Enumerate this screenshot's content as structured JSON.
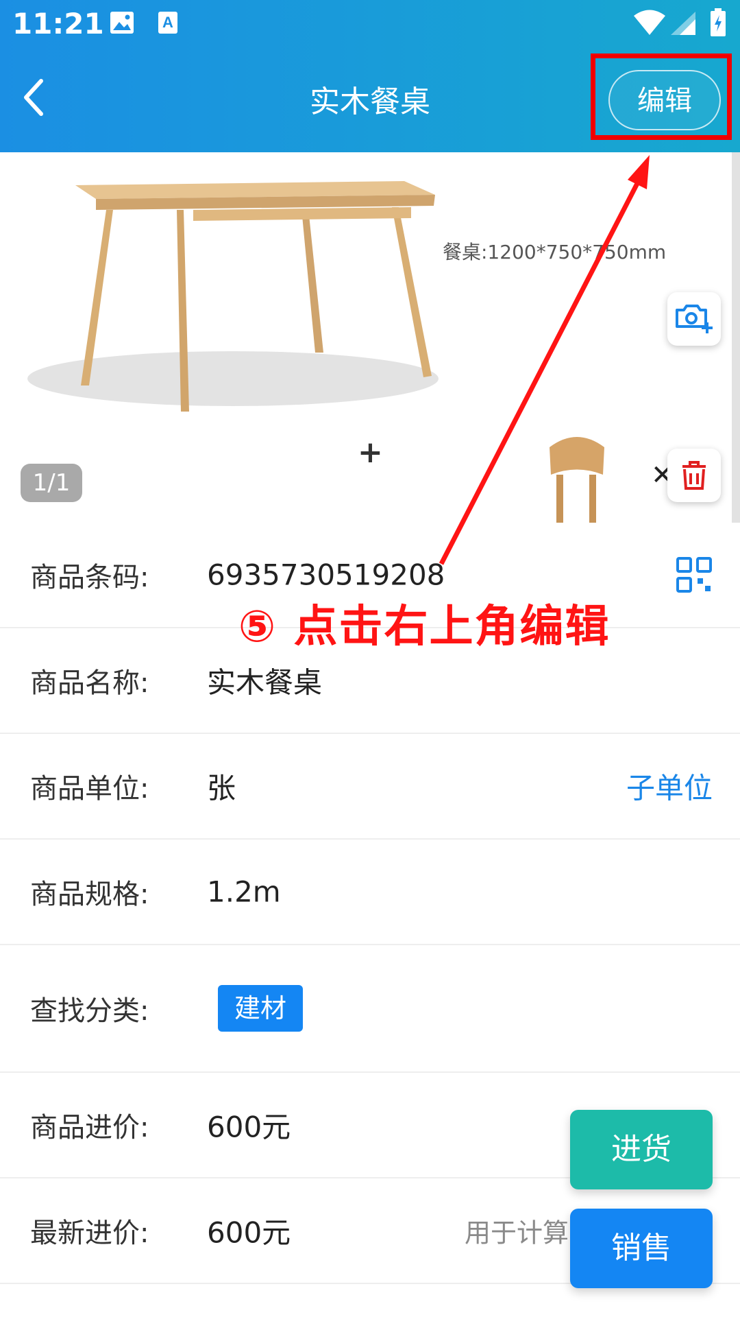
{
  "status_bar": {
    "time": "11:21"
  },
  "header": {
    "title": "实木餐桌",
    "edit_label": "编辑"
  },
  "gallery": {
    "dimension_text": "餐桌:1200*750*750mm",
    "page_indicator": "1/1",
    "add_symbol": "+"
  },
  "rows": {
    "barcode": {
      "label": "商品条码:",
      "value": "6935730519208"
    },
    "name": {
      "label": "商品名称:",
      "value": "实木餐桌"
    },
    "unit": {
      "label": "商品单位:",
      "value": "张",
      "link": "子单位"
    },
    "spec": {
      "label": "商品规格:",
      "value": "1.2m"
    },
    "category": {
      "label": "查找分类:",
      "tag": "建材"
    },
    "purchase_price": {
      "label": "商品进价:",
      "value": "600元"
    },
    "latest_price": {
      "label": "最新进价:",
      "value": "600元",
      "hint": "用于计算"
    }
  },
  "annotation": {
    "text": "⑤ 点击右上角编辑"
  },
  "buttons": {
    "stock_in": "进货",
    "sell": "销售"
  },
  "colors": {
    "header_start": "#1b8fe3",
    "header_end": "#17a8cf",
    "accent_blue": "#1486f3",
    "teal": "#1dbba9",
    "annotation_red": "#ff1414"
  }
}
